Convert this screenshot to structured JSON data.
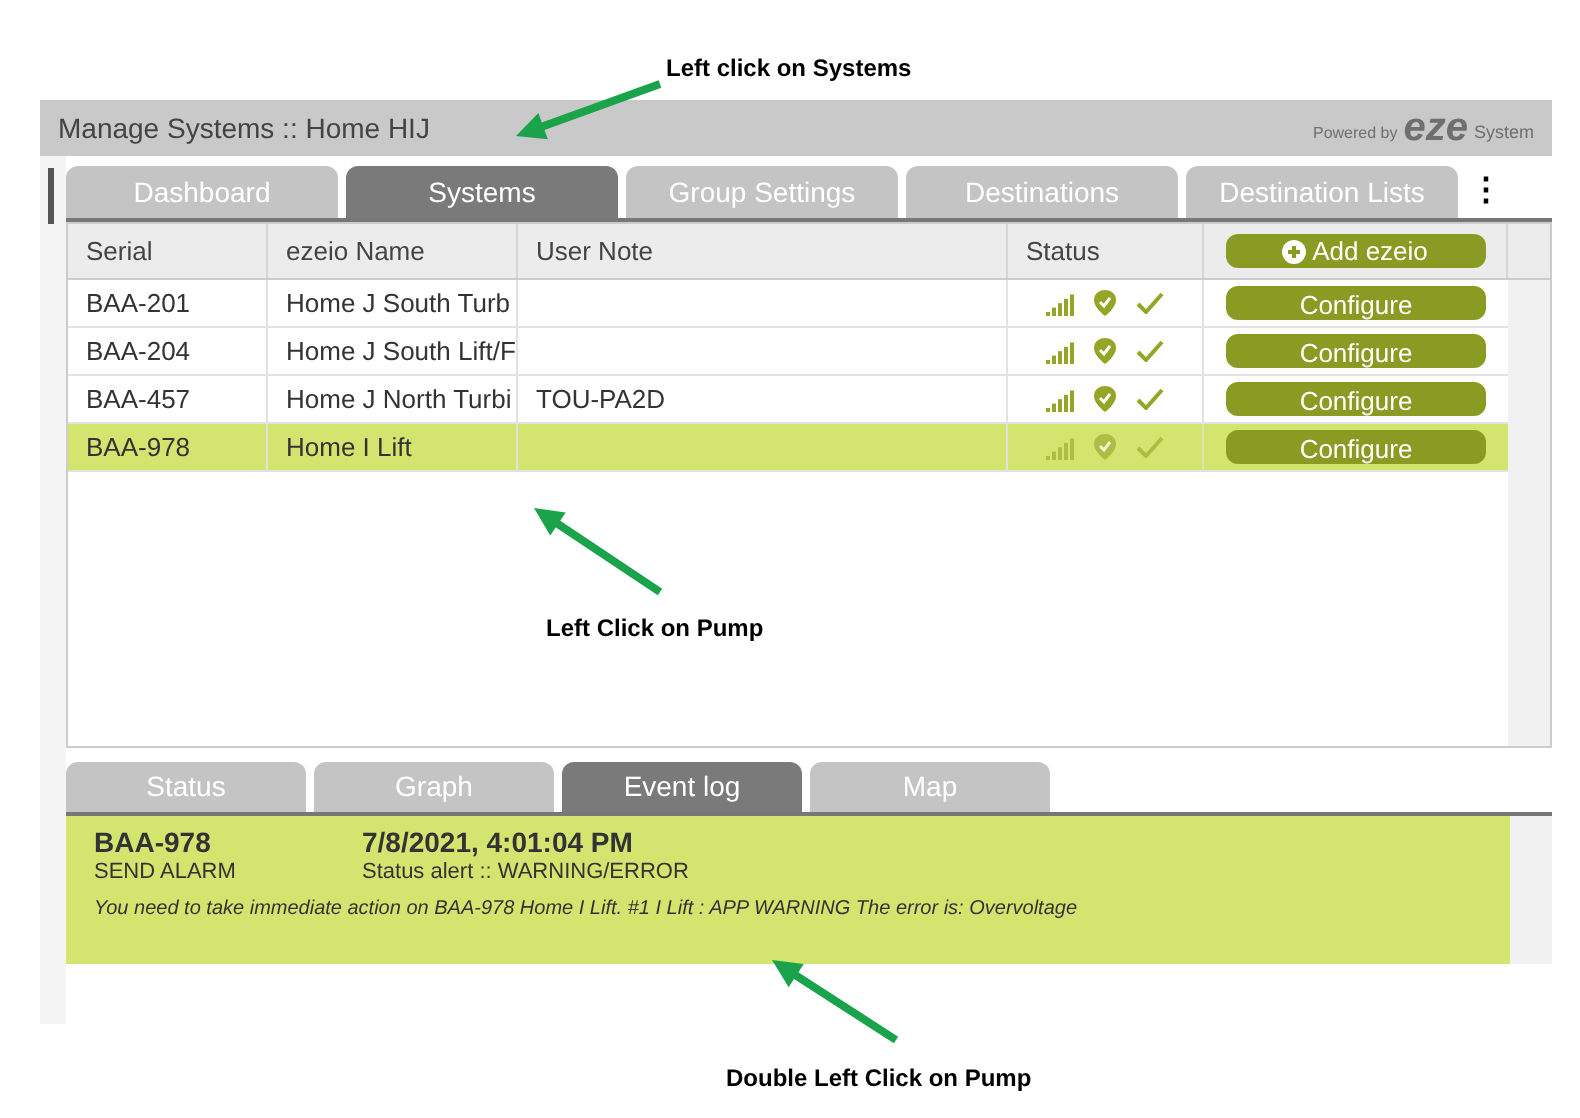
{
  "header": {
    "title": "Manage Systems :: Home HIJ",
    "brand_prefix": "Powered by",
    "brand_logo": "eze",
    "brand_suffix": "System"
  },
  "tabs": [
    {
      "label": "Dashboard",
      "selected": false
    },
    {
      "label": "Systems",
      "selected": true
    },
    {
      "label": "Group Settings",
      "selected": false
    },
    {
      "label": "Destinations",
      "selected": false
    },
    {
      "label": "Destination Lists",
      "selected": false
    }
  ],
  "more_menu": "⋮",
  "table": {
    "columns": [
      "Serial",
      "ezeio Name",
      "User Note",
      "Status"
    ],
    "add_button": "Add ezeio",
    "rows": [
      {
        "serial": "BAA-201",
        "name": "Home J South Turb",
        "note": "",
        "action": "Configure",
        "selected": false
      },
      {
        "serial": "BAA-204",
        "name": "Home J South Lift/F",
        "note": "",
        "action": "Configure",
        "selected": false
      },
      {
        "serial": "BAA-457",
        "name": "Home J North Turbi",
        "note": "TOU-PA2D",
        "action": "Configure",
        "selected": false
      },
      {
        "serial": "BAA-978",
        "name": "Home I Lift",
        "note": "",
        "action": "Configure",
        "selected": true
      }
    ]
  },
  "detail_tabs": [
    {
      "label": "Status",
      "selected": false
    },
    {
      "label": "Graph",
      "selected": false
    },
    {
      "label": "Event log",
      "selected": true
    },
    {
      "label": "Map",
      "selected": false
    }
  ],
  "event": {
    "serial": "BAA-978",
    "time": "7/8/2021, 4:01:04 PM",
    "type": "SEND ALARM",
    "status": "Status alert :: WARNING/ERROR",
    "message": "You need to take immediate action on BAA-978 Home I Lift. #1 I Lift : APP WARNING The error is: Overvoltage"
  },
  "annotations": [
    {
      "text": "Left click on Systems"
    },
    {
      "text": "Left Click on Pump"
    },
    {
      "text": "Double Left Click on Pump"
    }
  ]
}
